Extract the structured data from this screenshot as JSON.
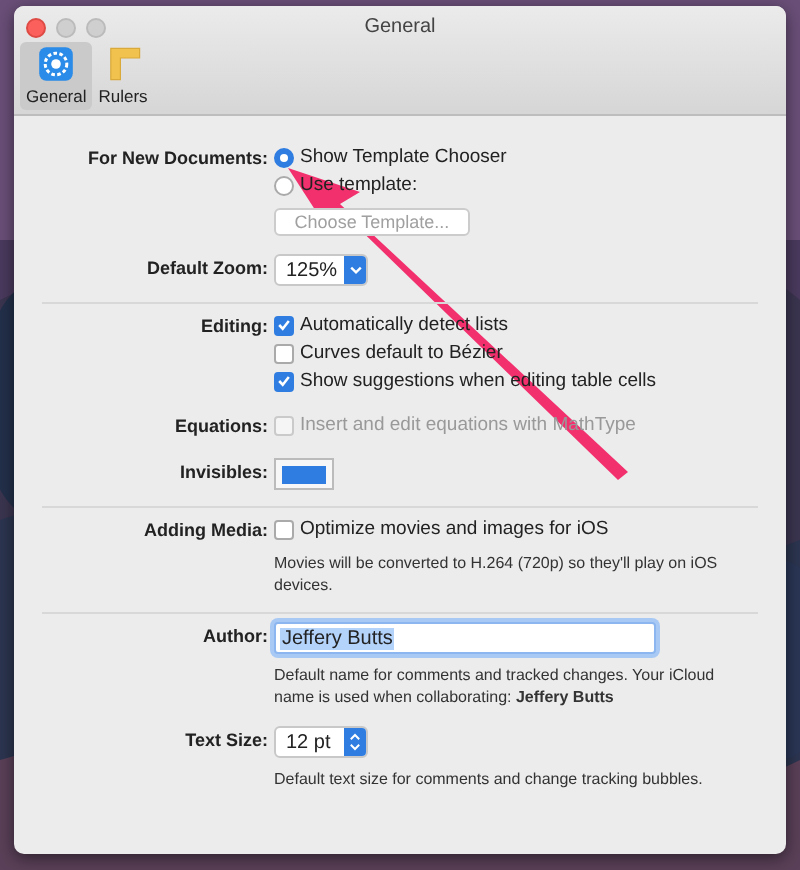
{
  "window": {
    "title": "General"
  },
  "tabs": [
    {
      "label": "General",
      "kind": "gear",
      "selected": true
    },
    {
      "label": "Rulers",
      "kind": "ruler",
      "selected": false
    }
  ],
  "sections": [
    [
      {
        "label": "For New Documents:",
        "kind": "radios",
        "options": [
          {
            "label": "Show Template Chooser",
            "selected": true
          },
          {
            "label": "Use template:",
            "selected": false
          }
        ],
        "button": {
          "label": "Choose Template...",
          "disabled": true
        }
      },
      {
        "label": "Default Zoom:",
        "kind": "popup",
        "value": "125%"
      }
    ],
    [
      {
        "label": "Editing:",
        "kind": "checks",
        "disabled": false,
        "options": [
          {
            "label": "Automatically detect lists",
            "checked": true
          },
          {
            "label": "Curves default to Bézier",
            "checked": false
          },
          {
            "label": "Show suggestions when editing table cells",
            "checked": true
          }
        ]
      },
      {
        "label": "Equations:",
        "kind": "checks",
        "disabled": true,
        "options": [
          {
            "label": "Insert and edit equations with MathType",
            "checked": false
          }
        ]
      },
      {
        "label": "Invisibles:",
        "kind": "color",
        "color": "#2f7de1"
      }
    ],
    [
      {
        "label": "Adding Media:",
        "kind": "checks",
        "disabled": false,
        "options": [
          {
            "label": "Optimize movies and images for iOS",
            "checked": false
          }
        ],
        "note": "Movies will be converted to H.264 (720p) so they'll play on iOS devices."
      }
    ],
    [
      {
        "label": "Author:",
        "kind": "text",
        "value": "Jeffery Butts",
        "selected": true,
        "note": "Default name for comments and tracked changes. Your iCloud name is used when collaborating: **Jeffery Butts**"
      },
      {
        "label": "Text Size:",
        "kind": "stepper",
        "value": "12 pt",
        "note": "Default text size for comments and change tracking bubbles."
      }
    ]
  ]
}
